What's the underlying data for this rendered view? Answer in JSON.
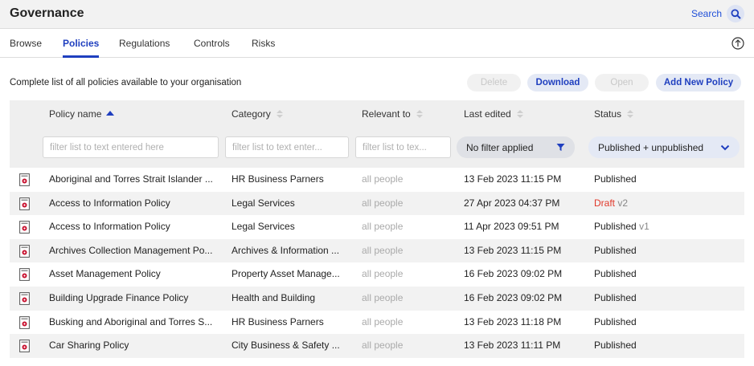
{
  "header": {
    "title": "Governance",
    "search_label": "Search"
  },
  "tabs": [
    {
      "label": "Browse",
      "active": false
    },
    {
      "label": "Policies",
      "active": true
    },
    {
      "label": "Regulations",
      "active": false
    },
    {
      "label": "Controls",
      "active": false
    },
    {
      "label": "Risks",
      "active": false
    }
  ],
  "subtitle": "Complete list of all policies available to your organisation",
  "actions": {
    "delete": "Delete",
    "download": "Download",
    "open": "Open",
    "add": "Add New Policy"
  },
  "columns": {
    "name": "Policy name",
    "category": "Category",
    "relevant": "Relevant to",
    "edited": "Last edited",
    "status": "Status"
  },
  "filters": {
    "name_placeholder": "filter list to text entered here",
    "category_placeholder": "filter list to text enter...",
    "relevant_placeholder": "filter list to tex...",
    "edited_value": "No filter applied",
    "status_value": "Published + unpublished"
  },
  "rows": [
    {
      "name": "Aboriginal and Torres Strait Islander ...",
      "category": "HR Business Parners",
      "relevant": "all people",
      "edited": "13 Feb 2023 11:15 PM",
      "status": "Published",
      "version": ""
    },
    {
      "name": "Access to Information Policy",
      "category": "Legal Services",
      "relevant": "all people",
      "edited": "27 Apr 2023 04:37 PM",
      "status": "Draft",
      "version": "v2"
    },
    {
      "name": "Access to Information Policy",
      "category": "Legal Services",
      "relevant": "all people",
      "edited": "11 Apr 2023 09:51 PM",
      "status": "Published",
      "version": "v1"
    },
    {
      "name": "Archives Collection Management Po...",
      "category": "Archives & Information ...",
      "relevant": "all people",
      "edited": "13 Feb 2023 11:15 PM",
      "status": "Published",
      "version": ""
    },
    {
      "name": "Asset Management Policy",
      "category": "Property Asset Manage...",
      "relevant": "all people",
      "edited": "16 Feb 2023 09:02 PM",
      "status": "Published",
      "version": ""
    },
    {
      "name": "Building Upgrade Finance Policy",
      "category": "Health and Building",
      "relevant": "all people",
      "edited": "16 Feb 2023 09:02 PM",
      "status": "Published",
      "version": ""
    },
    {
      "name": "Busking and Aboriginal and Torres S...",
      "category": "HR Business Parners",
      "relevant": "all people",
      "edited": "13 Feb 2023 11:18 PM",
      "status": "Published",
      "version": ""
    },
    {
      "name": "Car Sharing Policy",
      "category": "City Business & Safety ...",
      "relevant": "all people",
      "edited": "13 Feb 2023 11:11 PM",
      "status": "Published",
      "version": ""
    }
  ],
  "colors": {
    "accent": "#1f3fbf",
    "draft": "#e0392b",
    "icon_red": "#c8102e"
  }
}
